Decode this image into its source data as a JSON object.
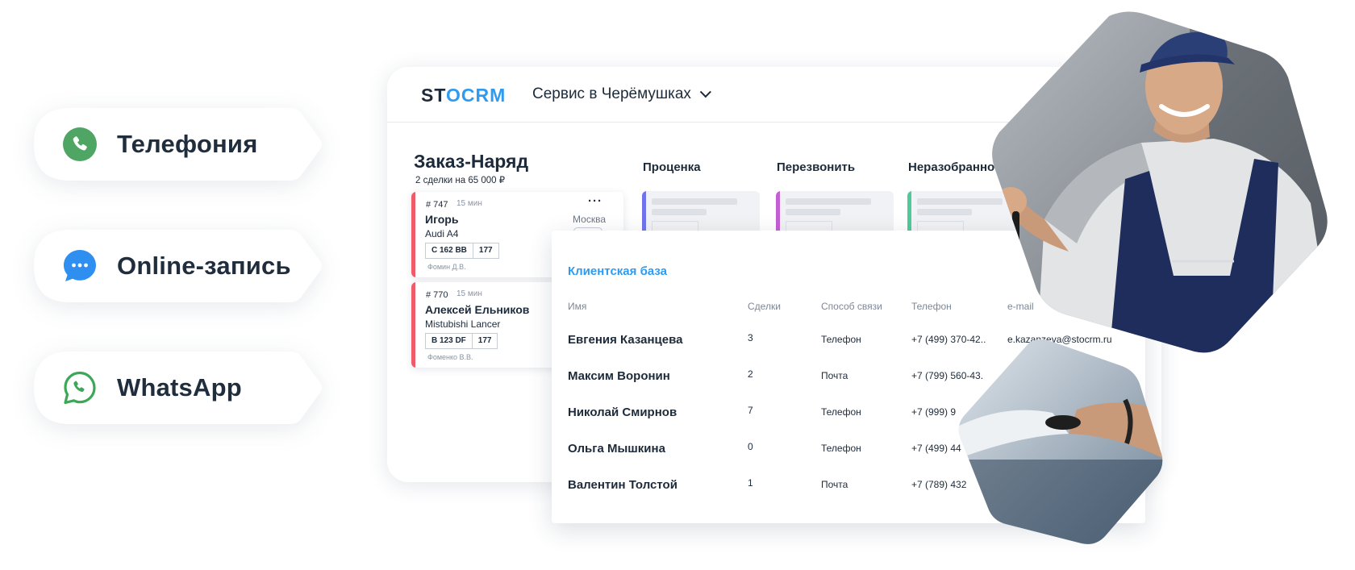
{
  "channels": [
    {
      "label": "Телефония",
      "icon": "phone-icon",
      "color": "#4fa564"
    },
    {
      "label": "Online-запись",
      "icon": "chat-icon",
      "color": "#2f8ff0"
    },
    {
      "label": "WhatsApp",
      "icon": "whatsapp-icon",
      "color": "#3aa857"
    }
  ],
  "app": {
    "logo": "STOCRM",
    "branch": "Сервис в Черёмушках"
  },
  "board": {
    "title": "Заказ-Наряд",
    "summary": "2 сделки на 65 000 ₽",
    "stages": [
      {
        "label": "Проценка",
        "color": "#6f74ec"
      },
      {
        "label": "Перезвонить",
        "color": "#c45ed4"
      },
      {
        "label": "Неразобранное",
        "color": "#4ecb98"
      }
    ],
    "cards": [
      {
        "number": "# 747",
        "time": "15 мин",
        "name": "Игорь",
        "car": "Audi A4",
        "plate": "С 162 ВВ",
        "region": "177",
        "manager": "Фомин Д.В.",
        "city": "Москва"
      },
      {
        "number": "# 770",
        "time": "15 мин",
        "name": "Алексей Ельников",
        "car": "Mistubishi Lancer",
        "plate": "В 123 DF",
        "region": "177",
        "manager": "Фоменко В.В."
      }
    ]
  },
  "clients": {
    "title": "Клиентская база",
    "columns": [
      "Имя",
      "Сделки",
      "Способ связи",
      "Телефон",
      "e-mail"
    ],
    "rows": [
      {
        "name": "Евгения Казанцева",
        "deals": "3",
        "contact": "Телефон",
        "phone": "+7 (499) 370-42..",
        "email": "e.kazanzeva@stocrm.ru"
      },
      {
        "name": "Максим Воронин",
        "deals": "2",
        "contact": "Почта",
        "phone": "+7 (799) 560-43.",
        "email": ""
      },
      {
        "name": "Николай Смирнов",
        "deals": "7",
        "contact": "Телефон",
        "phone": "+7 (999) 9",
        "email": ""
      },
      {
        "name": "Ольга Мышкина",
        "deals": "0",
        "contact": "Телефон",
        "phone": "+7 (499) 44",
        "email": ""
      },
      {
        "name": "Валентин Толстой",
        "deals": "1",
        "contact": "Почта",
        "phone": "+7 (789) 432",
        "email": ""
      }
    ]
  }
}
